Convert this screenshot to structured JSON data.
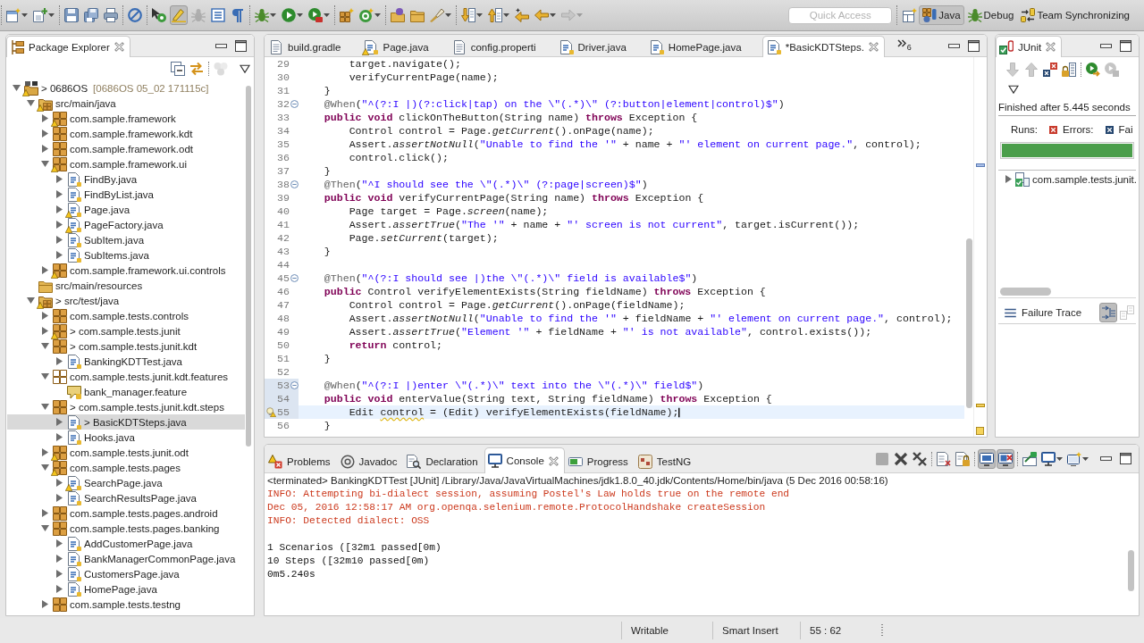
{
  "main_toolbar": {
    "buttons": [
      {
        "pressed": false,
        "disabled": false
      },
      {
        "pressed": false,
        "disabled": false
      },
      {
        "pressed": false,
        "disabled": false
      },
      {
        "pressed": false,
        "disabled": false
      },
      {
        "pressed": false,
        "disabled": false
      },
      {
        "pressed": false,
        "disabled": false
      },
      {
        "pressed": false,
        "disabled": false
      },
      {
        "pressed": true,
        "disabled": false
      },
      {
        "pressed": false,
        "disabled": true
      },
      {
        "pressed": false,
        "disabled": false
      },
      {
        "pressed": false,
        "disabled": false
      },
      {
        "pressed": false,
        "disabled": false
      },
      {
        "pressed": false,
        "disabled": false
      },
      {
        "pressed": false,
        "disabled": false
      },
      {
        "pressed": false,
        "disabled": false
      },
      {
        "pressed": false,
        "disabled": false
      },
      {
        "pressed": false,
        "disabled": false
      },
      {
        "pressed": false,
        "disabled": false
      },
      {
        "pressed": false,
        "disabled": false
      },
      {
        "pressed": false,
        "disabled": false
      },
      {
        "pressed": false,
        "disabled": false
      },
      {
        "pressed": false,
        "disabled": false
      },
      {
        "pressed": false,
        "disabled": false
      },
      {
        "pressed": false,
        "disabled": true
      }
    ]
  },
  "quick_access": {
    "placeholder": "Quick Access"
  },
  "perspectives": [
    {
      "label": "Java",
      "selected": true
    },
    {
      "label": "Debug",
      "selected": false
    },
    {
      "label": "Team Synchronizing",
      "selected": false
    }
  ],
  "package_explorer": {
    "tab": {
      "label": "Package Explorer",
      "selected": true
    },
    "toolbar": {
      "buttons": [
        {
          "pressed": false,
          "disabled": false
        },
        {
          "pressed": false,
          "disabled": false
        },
        {
          "pressed": false,
          "disabled": true
        }
      ]
    },
    "tree": [
      {
        "label": "> 0686OS",
        "decoration": "[0686OS 05_02 171115c]",
        "kind": "project",
        "expanded": true,
        "selected": false,
        "warning": true,
        "children": [
          {
            "label": "src/main/java",
            "kind": "source_folder",
            "expanded": true,
            "selected": false,
            "warning": true,
            "children": [
              {
                "label": "com.sample.framework",
                "kind": "package",
                "expanded": false,
                "selected": false,
                "warning": true
              },
              {
                "label": "com.sample.framework.kdt",
                "kind": "package",
                "expanded": false,
                "selected": false,
                "warning": false
              },
              {
                "label": "com.sample.framework.odt",
                "kind": "package",
                "expanded": false,
                "selected": false,
                "warning": false
              },
              {
                "label": "com.sample.framework.ui",
                "kind": "package",
                "expanded": true,
                "selected": false,
                "warning": true,
                "children": [
                  {
                    "label": "FindBy.java",
                    "kind": "java",
                    "expanded": false,
                    "selected": false,
                    "warning": false
                  },
                  {
                    "label": "FindByList.java",
                    "kind": "java",
                    "expanded": false,
                    "selected": false,
                    "warning": false
                  },
                  {
                    "label": "Page.java",
                    "kind": "java",
                    "expanded": false,
                    "selected": false,
                    "warning": true
                  },
                  {
                    "label": "PageFactory.java",
                    "kind": "java",
                    "expanded": false,
                    "selected": false,
                    "warning": true
                  },
                  {
                    "label": "SubItem.java",
                    "kind": "java",
                    "expanded": false,
                    "selected": false,
                    "warning": false
                  },
                  {
                    "label": "SubItems.java",
                    "kind": "java",
                    "expanded": false,
                    "selected": false,
                    "warning": false
                  }
                ]
              },
              {
                "label": "com.sample.framework.ui.controls",
                "kind": "package",
                "expanded": false,
                "selected": false,
                "warning": true
              }
            ]
          },
          {
            "label": "src/main/resources",
            "kind": "folder",
            "selected": false,
            "warning": false
          },
          {
            "label": "> src/test/java",
            "kind": "source_folder",
            "expanded": true,
            "selected": false,
            "warning": true,
            "children": [
              {
                "label": "com.sample.tests.controls",
                "kind": "package",
                "expanded": false,
                "selected": false,
                "warning": false
              },
              {
                "label": "> com.sample.tests.junit",
                "kind": "package",
                "expanded": false,
                "selected": false,
                "warning": true
              },
              {
                "label": "> com.sample.tests.junit.kdt",
                "kind": "package",
                "expanded": true,
                "selected": false,
                "warning": false,
                "children": [
                  {
                    "label": "BankingKDTTest.java",
                    "kind": "java",
                    "expanded": false,
                    "selected": false,
                    "warning": false
                  }
                ]
              },
              {
                "label": "com.sample.tests.junit.kdt.features",
                "kind": "empty_package",
                "expanded": true,
                "selected": false,
                "warning": false,
                "children": [
                  {
                    "label": "bank_manager.feature",
                    "kind": "feature",
                    "selected": false,
                    "warning": false
                  }
                ]
              },
              {
                "label": "> com.sample.tests.junit.kdt.steps",
                "kind": "package",
                "expanded": true,
                "selected": false,
                "warning": false,
                "children": [
                  {
                    "label": "> BasicKDTSteps.java",
                    "kind": "java",
                    "expanded": false,
                    "selected": true,
                    "warning": false
                  },
                  {
                    "label": "Hooks.java",
                    "kind": "java",
                    "expanded": false,
                    "selected": false,
                    "warning": false
                  }
                ]
              },
              {
                "label": "com.sample.tests.junit.odt",
                "kind": "package",
                "expanded": false,
                "selected": false,
                "warning": true
              },
              {
                "label": "com.sample.tests.pages",
                "kind": "package",
                "expanded": true,
                "selected": false,
                "warning": true,
                "children": [
                  {
                    "label": "SearchPage.java",
                    "kind": "java",
                    "expanded": false,
                    "selected": false,
                    "warning": true
                  },
                  {
                    "label": "SearchResultsPage.java",
                    "kind": "java",
                    "expanded": false,
                    "selected": false,
                    "warning": false
                  }
                ]
              },
              {
                "label": "com.sample.tests.pages.android",
                "kind": "package",
                "expanded": false,
                "selected": false,
                "warning": false
              },
              {
                "label": "com.sample.tests.pages.banking",
                "kind": "package",
                "expanded": true,
                "selected": false,
                "warning": false,
                "children": [
                  {
                    "label": "AddCustomerPage.java",
                    "kind": "java",
                    "expanded": false,
                    "selected": false,
                    "warning": false
                  },
                  {
                    "label": "BankManagerCommonPage.java",
                    "kind": "java",
                    "expanded": false,
                    "selected": false,
                    "warning": false
                  },
                  {
                    "label": "CustomersPage.java",
                    "kind": "java",
                    "expanded": false,
                    "selected": false,
                    "warning": false
                  },
                  {
                    "label": "HomePage.java",
                    "kind": "java",
                    "expanded": false,
                    "selected": false,
                    "warning": false
                  }
                ]
              },
              {
                "label": "com.sample.tests.testng",
                "kind": "package",
                "expanded": false,
                "selected": false,
                "warning": false
              }
            ]
          }
        ]
      }
    ]
  },
  "editor": {
    "tabs": [
      {
        "label": "build.gradle",
        "kind": "text",
        "selected": false,
        "warning": false
      },
      {
        "label": "Page.java",
        "kind": "java",
        "selected": false,
        "warning": true
      },
      {
        "label": "config.properti",
        "kind": "text",
        "selected": false,
        "warning": false
      },
      {
        "label": "Driver.java",
        "kind": "java",
        "selected": false,
        "warning": false
      },
      {
        "label": "HomePage.java",
        "kind": "java",
        "selected": false,
        "warning": false
      },
      {
        "label": "*BasicKDTSteps.",
        "kind": "java",
        "selected": true,
        "warning": false
      }
    ],
    "overflow_count": "6",
    "lines": [
      {
        "number": "29",
        "tokens": [
          {
            "text": "        target.navigate();",
            "kind": "plain"
          }
        ],
        "collapsible": false,
        "current": false,
        "changed": false,
        "warning": false
      },
      {
        "number": "30",
        "tokens": [
          {
            "text": "        verifyCurrentPage(name);",
            "kind": "plain"
          }
        ],
        "collapsible": false,
        "current": false,
        "changed": false,
        "warning": false
      },
      {
        "number": "31",
        "tokens": [
          {
            "text": "    }",
            "kind": "plain"
          }
        ],
        "collapsible": false,
        "current": false,
        "changed": false,
        "warning": false
      },
      {
        "number": "32",
        "tokens": [
          {
            "text": "    @When",
            "kind": "annotation"
          },
          {
            "text": "(",
            "kind": "plain"
          },
          {
            "text": "\"^(?:I |)(?:click|tap) on the \\\"(.*)\\\" (?:button|element|control)$\"",
            "kind": "string"
          },
          {
            "text": ")",
            "kind": "plain"
          }
        ],
        "collapsible": true,
        "current": false,
        "changed": false,
        "warning": false
      },
      {
        "number": "33",
        "tokens": [
          {
            "text": "    public void",
            "kind": "keyword"
          },
          {
            "text": " clickOnTheButton(String name) ",
            "kind": "plain"
          },
          {
            "text": "throws",
            "kind": "keyword"
          },
          {
            "text": " Exception {",
            "kind": "plain"
          }
        ],
        "collapsible": false,
        "current": false,
        "changed": false,
        "warning": false
      },
      {
        "number": "34",
        "tokens": [
          {
            "text": "        Control control = Page.",
            "kind": "plain"
          },
          {
            "text": "getCurrent",
            "kind": "static"
          },
          {
            "text": "().onPage(name);",
            "kind": "plain"
          }
        ],
        "collapsible": false,
        "current": false,
        "changed": false,
        "warning": false
      },
      {
        "number": "35",
        "tokens": [
          {
            "text": "        Assert.",
            "kind": "plain"
          },
          {
            "text": "assertNotNull",
            "kind": "static"
          },
          {
            "text": "(",
            "kind": "plain"
          },
          {
            "text": "\"Unable to find the '\"",
            "kind": "string"
          },
          {
            "text": " + name + ",
            "kind": "plain"
          },
          {
            "text": "\"' element on current page.\"",
            "kind": "string"
          },
          {
            "text": ", control);",
            "kind": "plain"
          }
        ],
        "collapsible": false,
        "current": false,
        "changed": false,
        "warning": false
      },
      {
        "number": "36",
        "tokens": [
          {
            "text": "        control.click();",
            "kind": "plain"
          }
        ],
        "collapsible": false,
        "current": false,
        "changed": false,
        "warning": false
      },
      {
        "number": "37",
        "tokens": [
          {
            "text": "    }",
            "kind": "plain"
          }
        ],
        "collapsible": false,
        "current": false,
        "changed": false,
        "warning": false
      },
      {
        "number": "38",
        "tokens": [
          {
            "text": "    @Then",
            "kind": "annotation"
          },
          {
            "text": "(",
            "kind": "plain"
          },
          {
            "text": "\"^I should see the \\\"(.*)\\\" (?:page|screen)$\"",
            "kind": "string"
          },
          {
            "text": ")",
            "kind": "plain"
          }
        ],
        "collapsible": true,
        "current": false,
        "changed": false,
        "warning": false
      },
      {
        "number": "39",
        "tokens": [
          {
            "text": "    public void",
            "kind": "keyword"
          },
          {
            "text": " verifyCurrentPage(String name) ",
            "kind": "plain"
          },
          {
            "text": "throws",
            "kind": "keyword"
          },
          {
            "text": " Exception {",
            "kind": "plain"
          }
        ],
        "collapsible": false,
        "current": false,
        "changed": false,
        "warning": false
      },
      {
        "number": "40",
        "tokens": [
          {
            "text": "        Page target = Page.",
            "kind": "plain"
          },
          {
            "text": "screen",
            "kind": "static"
          },
          {
            "text": "(name);",
            "kind": "plain"
          }
        ],
        "collapsible": false,
        "current": false,
        "changed": false,
        "warning": false
      },
      {
        "number": "41",
        "tokens": [
          {
            "text": "        Assert.",
            "kind": "plain"
          },
          {
            "text": "assertTrue",
            "kind": "static"
          },
          {
            "text": "(",
            "kind": "plain"
          },
          {
            "text": "\"The '\"",
            "kind": "string"
          },
          {
            "text": " + name + ",
            "kind": "plain"
          },
          {
            "text": "\"' screen is not current\"",
            "kind": "string"
          },
          {
            "text": ", target.isCurrent());",
            "kind": "plain"
          }
        ],
        "collapsible": false,
        "current": false,
        "changed": false,
        "warning": false
      },
      {
        "number": "42",
        "tokens": [
          {
            "text": "        Page.",
            "kind": "plain"
          },
          {
            "text": "setCurrent",
            "kind": "static"
          },
          {
            "text": "(target);",
            "kind": "plain"
          }
        ],
        "collapsible": false,
        "current": false,
        "changed": false,
        "warning": false
      },
      {
        "number": "43",
        "tokens": [
          {
            "text": "    }",
            "kind": "plain"
          }
        ],
        "collapsible": false,
        "current": false,
        "changed": false,
        "warning": false
      },
      {
        "number": "44",
        "collapsible": false,
        "current": false,
        "changed": false,
        "warning": false
      },
      {
        "number": "45",
        "tokens": [
          {
            "text": "    @Then",
            "kind": "annotation"
          },
          {
            "text": "(",
            "kind": "plain"
          },
          {
            "text": "\"^(?:I should see |)the \\\"(.*)\\\" field is available$\"",
            "kind": "string"
          },
          {
            "text": ")",
            "kind": "plain"
          }
        ],
        "collapsible": true,
        "current": false,
        "changed": false,
        "warning": false
      },
      {
        "number": "46",
        "tokens": [
          {
            "text": "    public",
            "kind": "keyword"
          },
          {
            "text": " Control verifyElementExists(String fieldName) ",
            "kind": "plain"
          },
          {
            "text": "throws",
            "kind": "keyword"
          },
          {
            "text": " Exception {",
            "kind": "plain"
          }
        ],
        "collapsible": false,
        "current": false,
        "changed": false,
        "warning": false
      },
      {
        "number": "47",
        "tokens": [
          {
            "text": "        Control control = Page.",
            "kind": "plain"
          },
          {
            "text": "getCurrent",
            "kind": "static"
          },
          {
            "text": "().onPage(fieldName);",
            "kind": "plain"
          }
        ],
        "collapsible": false,
        "current": false,
        "changed": false,
        "warning": false
      },
      {
        "number": "48",
        "tokens": [
          {
            "text": "        Assert.",
            "kind": "plain"
          },
          {
            "text": "assertNotNull",
            "kind": "static"
          },
          {
            "text": "(",
            "kind": "plain"
          },
          {
            "text": "\"Unable to find the '\"",
            "kind": "string"
          },
          {
            "text": " + fieldName + ",
            "kind": "plain"
          },
          {
            "text": "\"' element on current page.\"",
            "kind": "string"
          },
          {
            "text": ", control);",
            "kind": "plain"
          }
        ],
        "collapsible": false,
        "current": false,
        "changed": false,
        "warning": false
      },
      {
        "number": "49",
        "tokens": [
          {
            "text": "        Assert.",
            "kind": "plain"
          },
          {
            "text": "assertTrue",
            "kind": "static"
          },
          {
            "text": "(",
            "kind": "plain"
          },
          {
            "text": "\"Element '\"",
            "kind": "string"
          },
          {
            "text": " + fieldName + ",
            "kind": "plain"
          },
          {
            "text": "\"' is not available\"",
            "kind": "string"
          },
          {
            "text": ", control.exists());",
            "kind": "plain"
          }
        ],
        "collapsible": false,
        "current": false,
        "changed": false,
        "warning": false
      },
      {
        "number": "50",
        "tokens": [
          {
            "text": "        return",
            "kind": "keyword"
          },
          {
            "text": " control;",
            "kind": "plain"
          }
        ],
        "collapsible": false,
        "current": false,
        "changed": false,
        "warning": false
      },
      {
        "number": "51",
        "tokens": [
          {
            "text": "    }",
            "kind": "plain"
          }
        ],
        "collapsible": false,
        "current": false,
        "changed": false,
        "warning": false
      },
      {
        "number": "52",
        "collapsible": false,
        "current": false,
        "changed": false,
        "warning": false
      },
      {
        "number": "53",
        "tokens": [
          {
            "text": "    @When",
            "kind": "annotation"
          },
          {
            "text": "(",
            "kind": "plain"
          },
          {
            "text": "\"^(?:I |)enter \\\"(.*)\\\" text into the \\\"(.*)\\\" field$\"",
            "kind": "string"
          },
          {
            "text": ")",
            "kind": "plain"
          }
        ],
        "collapsible": true,
        "current": false,
        "changed": true,
        "warning": false
      },
      {
        "number": "54",
        "tokens": [
          {
            "text": "    public void",
            "kind": "keyword"
          },
          {
            "text": " enterValue(String text, String fieldName) ",
            "kind": "plain"
          },
          {
            "text": "throws",
            "kind": "keyword"
          },
          {
            "text": " Exception {",
            "kind": "plain"
          }
        ],
        "collapsible": false,
        "current": false,
        "changed": true,
        "warning": false
      },
      {
        "number": "55",
        "tokens": [
          {
            "text": "        Edit ",
            "kind": "plain"
          },
          {
            "text": "control",
            "kind": "flagged"
          },
          {
            "text": " = (Edit) verifyElementExists(fieldName);",
            "kind": "plain"
          }
        ],
        "collapsible": false,
        "current": true,
        "changed": true,
        "warning": true
      },
      {
        "number": "56",
        "tokens": [
          {
            "text": "    }",
            "kind": "plain"
          }
        ],
        "collapsible": false,
        "current": false,
        "changed": false,
        "warning": false
      }
    ]
  },
  "junit": {
    "tab": {
      "label": "JUnit",
      "selected": true
    },
    "toolbar": {
      "buttons": [
        {
          "pressed": false,
          "disabled": true
        },
        {
          "pressed": false,
          "disabled": true
        },
        {
          "pressed": false,
          "disabled": false
        },
        {
          "pressed": false,
          "disabled": false
        },
        {
          "pressed": false,
          "disabled": false
        },
        {
          "pressed": false,
          "disabled": true
        }
      ]
    },
    "status": "Finished after 5.445 seconds",
    "counters": [
      {
        "label": "Runs:"
      },
      {
        "label": "Errors:"
      },
      {
        "label": "Fai"
      }
    ],
    "progress": {
      "level": 1,
      "failed": false
    },
    "tree": [
      {
        "label": "com.sample.tests.junit.",
        "expanded": false,
        "selected": false
      }
    ],
    "failure_trace": {
      "label": "Failure Trace",
      "toolbar": {
        "buttons": [
          {
            "pressed": true,
            "disabled": false
          },
          {
            "pressed": false,
            "disabled": true
          }
        ]
      }
    }
  },
  "console": {
    "tabs": [
      {
        "label": "Problems",
        "selected": false
      },
      {
        "label": "Javadoc",
        "selected": false
      },
      {
        "label": "Declaration",
        "selected": false
      },
      {
        "label": "Console",
        "selected": true
      },
      {
        "label": "Progress",
        "selected": false
      },
      {
        "label": "TestNG",
        "selected": false
      }
    ],
    "toolbar": {
      "buttons": [
        {
          "pressed": false,
          "disabled": true
        },
        {
          "pressed": false,
          "disabled": false
        },
        {
          "pressed": false,
          "disabled": false
        },
        {
          "pressed": false,
          "disabled": false
        },
        {
          "pressed": false,
          "disabled": false
        },
        {
          "pressed": true,
          "disabled": false
        },
        {
          "pressed": true,
          "disabled": false
        },
        {
          "pressed": false,
          "disabled": false
        },
        {
          "pressed": false,
          "disabled": false
        },
        {
          "pressed": false,
          "disabled": false
        }
      ]
    },
    "header": "<terminated> BankingKDTTest [JUnit] /Library/Java/JavaVirtualMachines/jdk1.8.0_40.jdk/Contents/Home/bin/java (5 Dec 2016 00:58:16)",
    "blocks": [
      {
        "lines": [
          {
            "text": "INFO: Attempting bi-dialect session, assuming Postel's Law holds true on the remote end",
            "kind": "stderr"
          },
          {
            "text": "Dec 05, 2016 12:58:17 AM org.openqa.selenium.remote.ProtocolHandshake createSession",
            "kind": "stderr"
          },
          {
            "text": "INFO: Detected dialect: OSS",
            "kind": "stderr"
          }
        ]
      },
      {
        "lines": [
          {
            "text": "1 Scenarios ([32m1 passed[0m)",
            "kind": "stdout"
          },
          {
            "text": "10 Steps ([32m10 passed[0m)",
            "kind": "stdout"
          },
          {
            "text": "0m5.240s",
            "kind": "stdout"
          }
        ]
      }
    ]
  },
  "status_bar": [
    "Writable",
    "Smart Insert",
    "55 : 62"
  ]
}
